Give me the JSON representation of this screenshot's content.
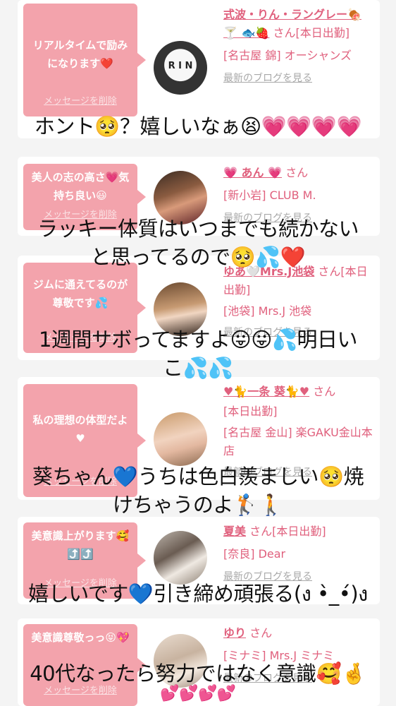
{
  "cards": [
    {
      "bubble_text": "リアルタイムで励みになります❤️",
      "delete_label": "メッセージを削除",
      "name": "式波・りん・ラングレー🍖🍸 🐟🍓",
      "san": "さん",
      "status": "[本日出勤]",
      "location": "[名古屋 錦] オーシャンズ",
      "blog_label": "最新のブログを見る"
    },
    {
      "bubble_text": "美人の志の高さ💗気持ち良い😃",
      "delete_label": "メッセージを削除",
      "name": "💗 あん 💗",
      "san": "さん",
      "location": "[新小岩] CLUB M.",
      "blog_label": "最新のブログを見る"
    },
    {
      "bubble_text": "ジムに通えてるのが尊敬です💦",
      "delete_label": "メッセージを削除",
      "name": "ゆあ🤍Mrs.J池袋",
      "san": "さん",
      "status": "[本日出勤]",
      "location": "[池袋] Mrs.J 池袋",
      "blog_label": "最新のブログを見る"
    },
    {
      "bubble_text": "私の理想の体型だよ♥",
      "delete_label": "メッセージを削除",
      "name": "♥🐈一条 葵🐈♥",
      "san": "さん",
      "status": "[本日出勤]",
      "location": "[名古屋 金山] 楽GAKU金山本店",
      "blog_label": "最新のブログを見る"
    },
    {
      "bubble_text": "美意識上がります🥰⤴️⤴️",
      "delete_label": "メッセージを削除",
      "name": "夏美",
      "san": "さん[本日出勤]",
      "location": "[奈良] Dear",
      "blog_label": "最新のブログを見る"
    },
    {
      "bubble_text": "美意識尊敬っっ😝💖",
      "delete_label": "メッセージを削除",
      "name": "ゆり",
      "san": "さん",
      "location": "[ミナミ] Mrs.J ミナミ",
      "blog_label": "最新のブログを見る"
    }
  ],
  "overlays": [
    "ホント🥺？嬉しいなぁ😫💗💗💗💗",
    "ラッキー体質はいつまでも続かない",
    "と思ってるので🥺💦❤️",
    "1週間サボってますよ😛😛💦明日い",
    "こ💦💦",
    "葵ちゃん💙うちは色白羨ましい🥺焼",
    "けちゃうのよ🏌️🚶",
    "嬉しいです💙引き締め頑張る(ง •̀_•́)ง",
    "40代なったら努力ではなく意識🥰🤞",
    "💕💕💕💕"
  ],
  "avatar_text": "R I N"
}
